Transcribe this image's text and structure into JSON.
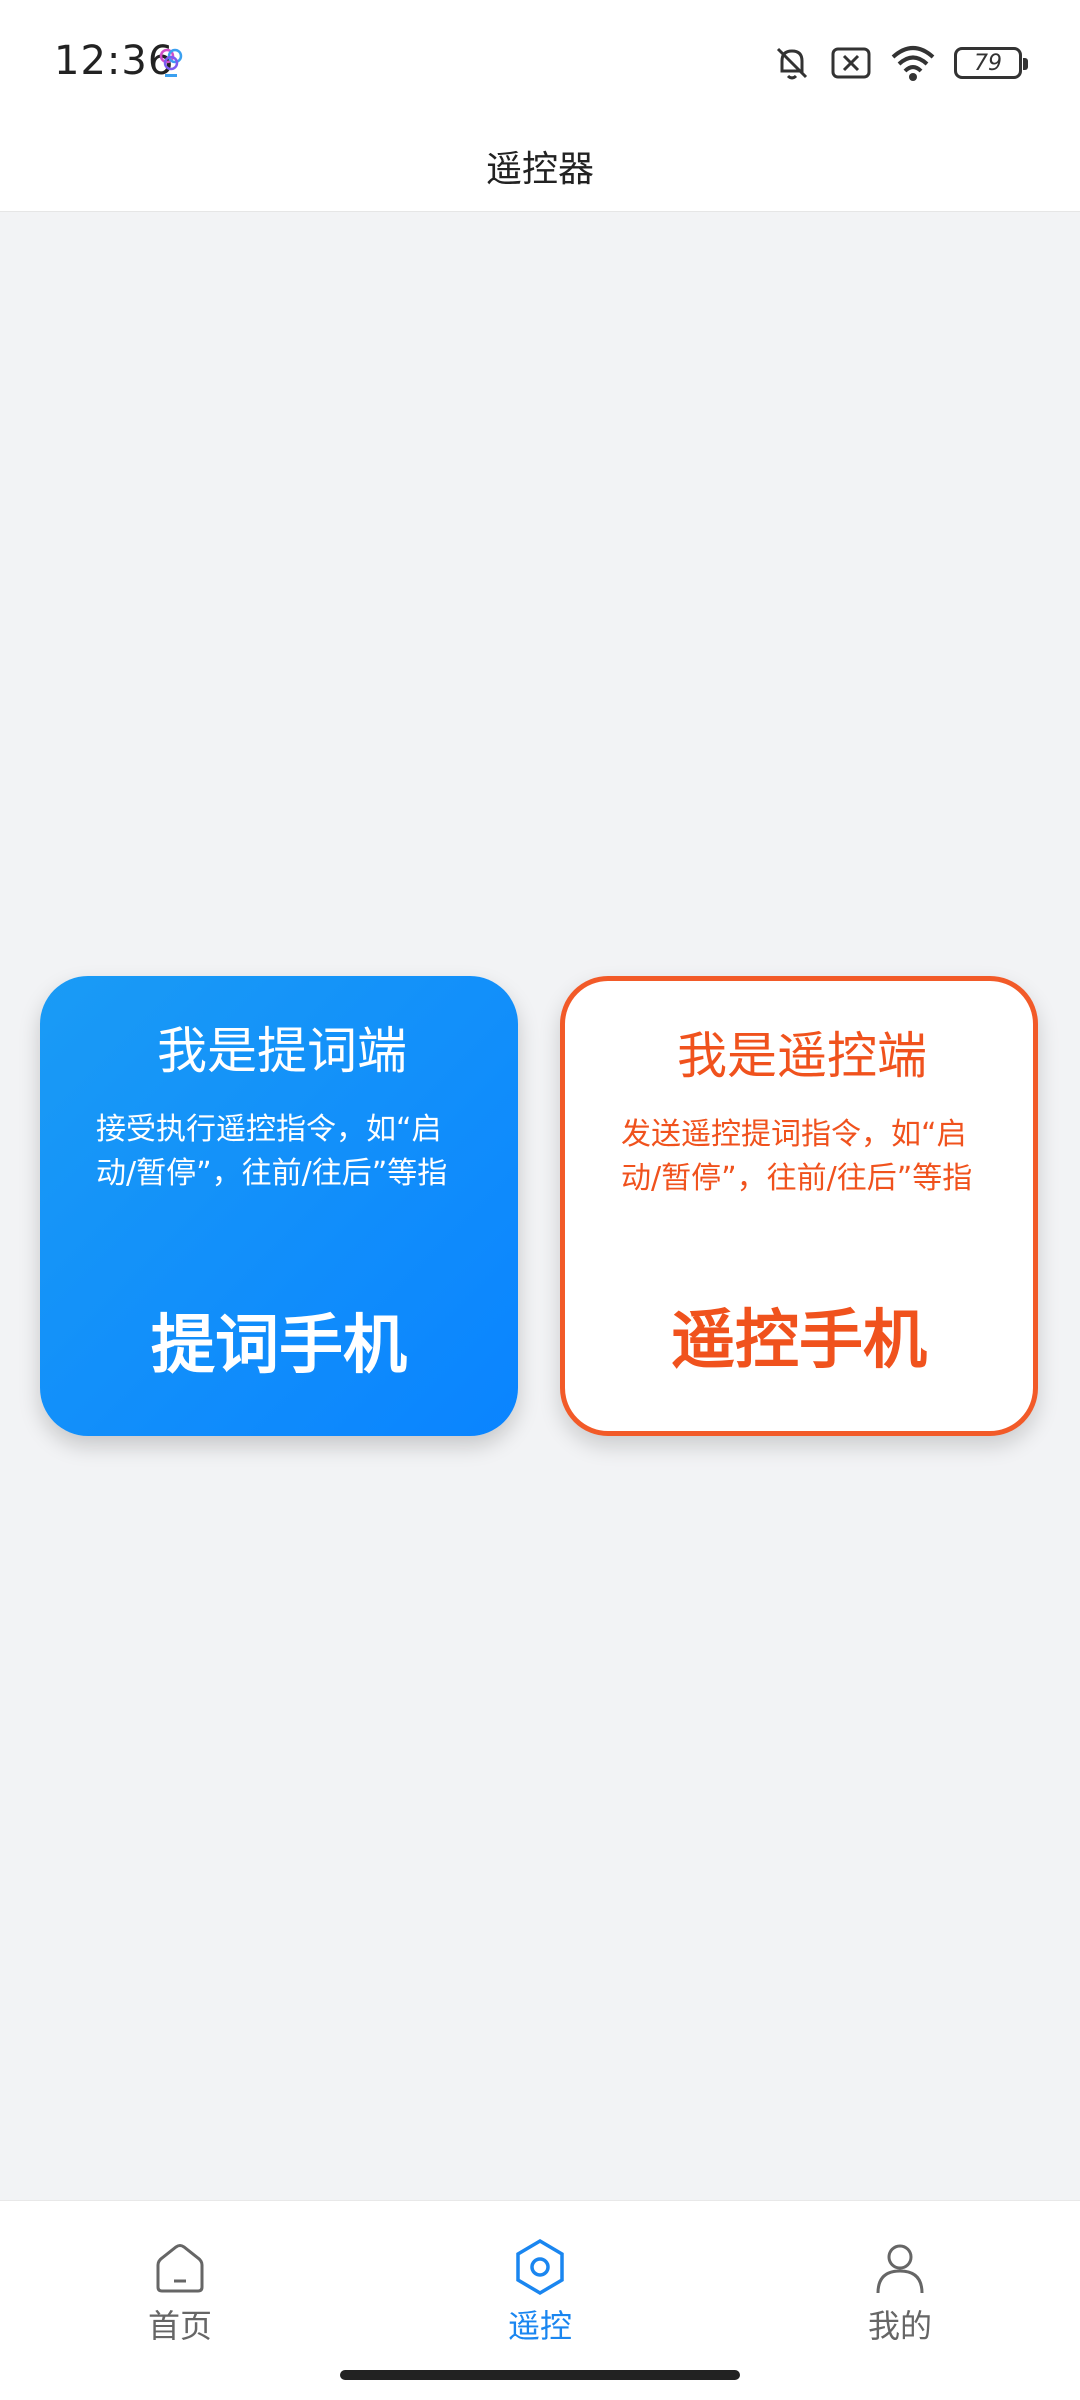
{
  "status_bar": {
    "time": "12:36",
    "battery": "79"
  },
  "header": {
    "title": "遥控器"
  },
  "cards": {
    "prompter": {
      "title": "我是提词端",
      "description": "接受执行遥控指令，如“启动/暂停”，往前/往后”等指",
      "footer": "提词手机",
      "color": "#0a84ff"
    },
    "remote": {
      "title": "我是遥控端",
      "description": "发送遥控提词指令，如“启动/暂停”，往前/往后”等指",
      "footer": "遥控手机",
      "color": "#f0521d"
    }
  },
  "bottom_nav": {
    "items": [
      {
        "label": "首页",
        "icon": "home-icon",
        "active": false
      },
      {
        "label": "遥控",
        "icon": "remote-hex-icon",
        "active": true
      },
      {
        "label": "我的",
        "icon": "user-icon",
        "active": false
      }
    ],
    "active_color": "#1a86f0"
  }
}
